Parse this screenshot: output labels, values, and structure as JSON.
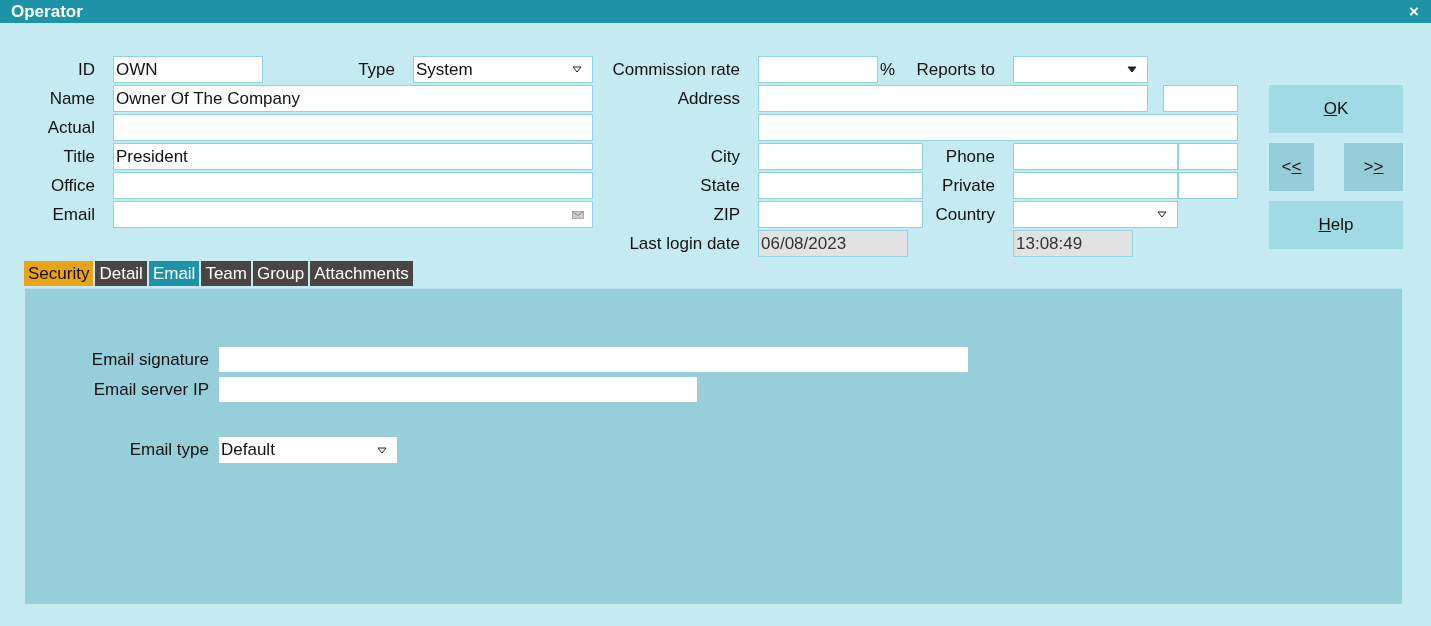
{
  "window": {
    "title": "Operator",
    "close": "×"
  },
  "form": {
    "id": {
      "label": "ID",
      "value": "OWN"
    },
    "type": {
      "label": "Type",
      "value": "System"
    },
    "commission_rate": {
      "label": "Commission rate",
      "suffix": "%"
    },
    "reports_to": {
      "label": "Reports to"
    },
    "name": {
      "label": "Name",
      "value": "Owner Of The Company"
    },
    "address": {
      "label": "Address"
    },
    "actual": {
      "label": "Actual"
    },
    "title": {
      "label": "Title",
      "value": "President"
    },
    "city": {
      "label": "City"
    },
    "phone": {
      "label": "Phone"
    },
    "office": {
      "label": "Office"
    },
    "state": {
      "label": "State"
    },
    "private": {
      "label": "Private"
    },
    "email": {
      "label": "Email"
    },
    "zip": {
      "label": "ZIP"
    },
    "country": {
      "label": "Country"
    },
    "last_login": {
      "label": "Last login date",
      "date": "06/08/2023",
      "time": "13:08:49",
      "disabled": true
    }
  },
  "buttons": [
    {
      "key": "O",
      "after": "K"
    },
    {
      "before": "<",
      "key": "<"
    },
    {
      "before": ">",
      "key": ">"
    },
    {
      "key": "H",
      "after": "elp"
    }
  ],
  "tabs": [
    {
      "label": "Security",
      "selected": false,
      "highlighted": true
    },
    {
      "label": "Detail",
      "selected": false,
      "highlighted": false
    },
    {
      "label": "Email",
      "selected": true,
      "highlighted": false
    },
    {
      "label": "Team",
      "selected": false,
      "highlighted": false
    },
    {
      "label": "Group",
      "selected": false,
      "highlighted": false
    },
    {
      "label": "Attachments",
      "selected": false,
      "highlighted": false
    }
  ],
  "email_tab": {
    "signature": {
      "label": "Email signature"
    },
    "server_ip": {
      "label": "Email server IP"
    },
    "email_type": {
      "label": "Email type",
      "value": "Default"
    }
  }
}
